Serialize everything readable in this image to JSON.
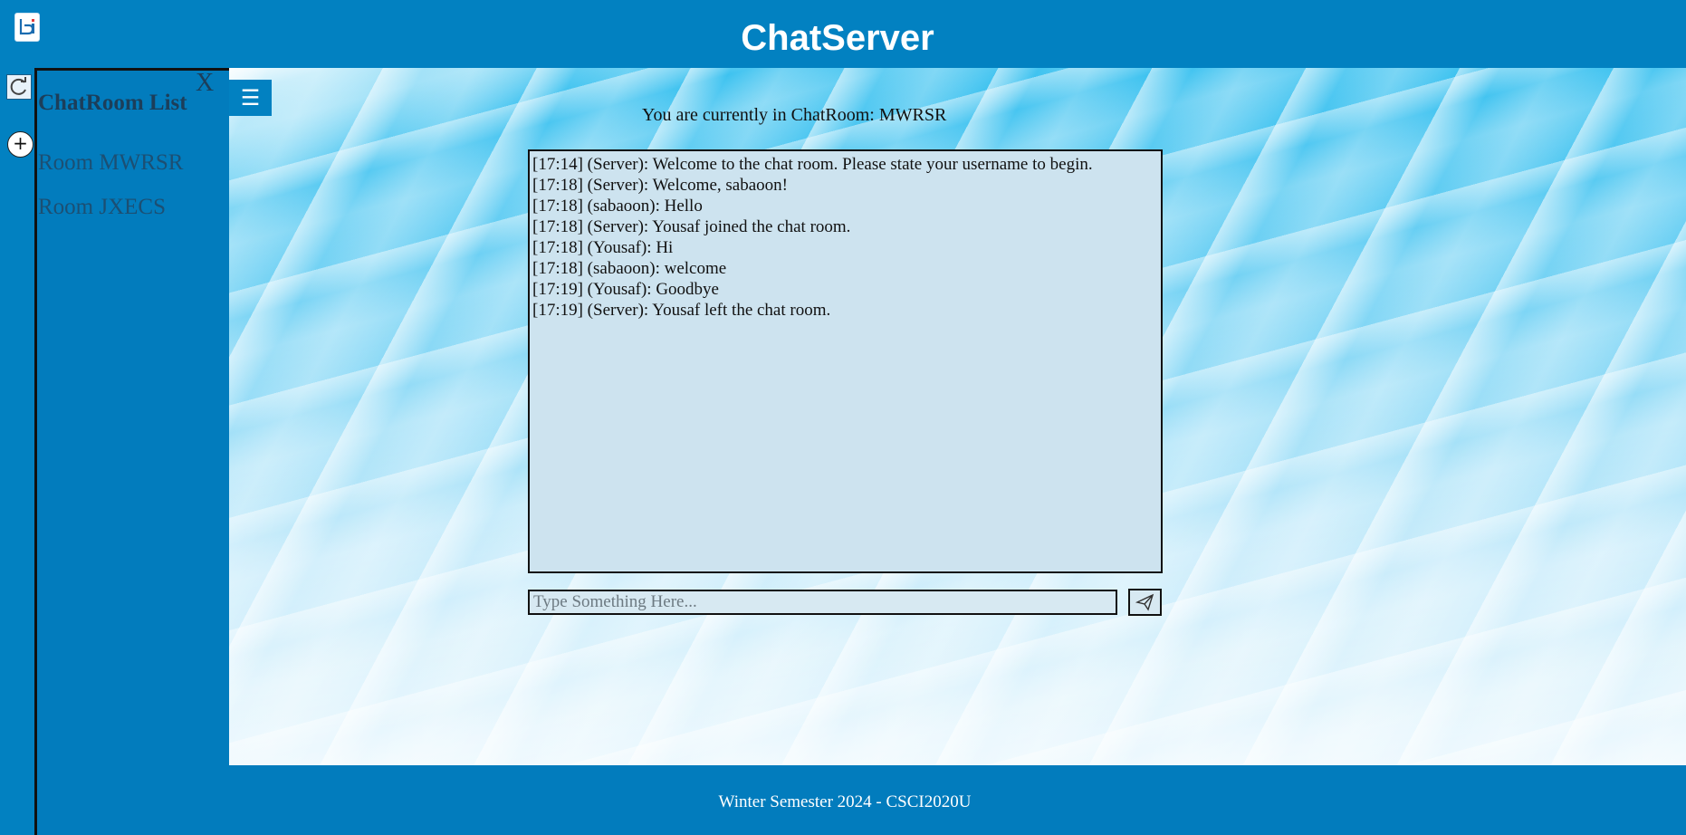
{
  "app": {
    "title": "ChatServer"
  },
  "sidebar": {
    "title": "ChatRoom List",
    "close_label": "X",
    "rooms": [
      {
        "label": "Room MWRSR"
      },
      {
        "label": "Room JXECS"
      }
    ]
  },
  "toolbar": {
    "add_label": "+",
    "menu_label": "☰"
  },
  "main": {
    "current_room_text": "You are currently in ChatRoom: MWRSR",
    "messages": [
      "[17:14] (Server): Welcome to the chat room. Please state your username to begin.",
      "[17:18] (Server): Welcome, sabaoon!",
      "[17:18] (sabaoon): Hello",
      "[17:18] (Server): Yousaf joined the chat room.",
      "[17:18] (Yousaf): Hi",
      "[17:18] (sabaoon): welcome",
      "[17:19] (Yousaf): Goodbye",
      "[17:19] (Server): Yousaf left the chat room."
    ],
    "input": {
      "placeholder": "Type Something Here...",
      "value": ""
    }
  },
  "footer": {
    "text": "Winter Semester 2024 - CSCI2020U"
  },
  "colors": {
    "primary": "#027cbd",
    "chat_bg": "#cde3ef"
  },
  "icons": {
    "logo": "app-logo-icon",
    "refresh": "refresh-icon",
    "send": "send-icon",
    "menu": "menu-icon"
  }
}
